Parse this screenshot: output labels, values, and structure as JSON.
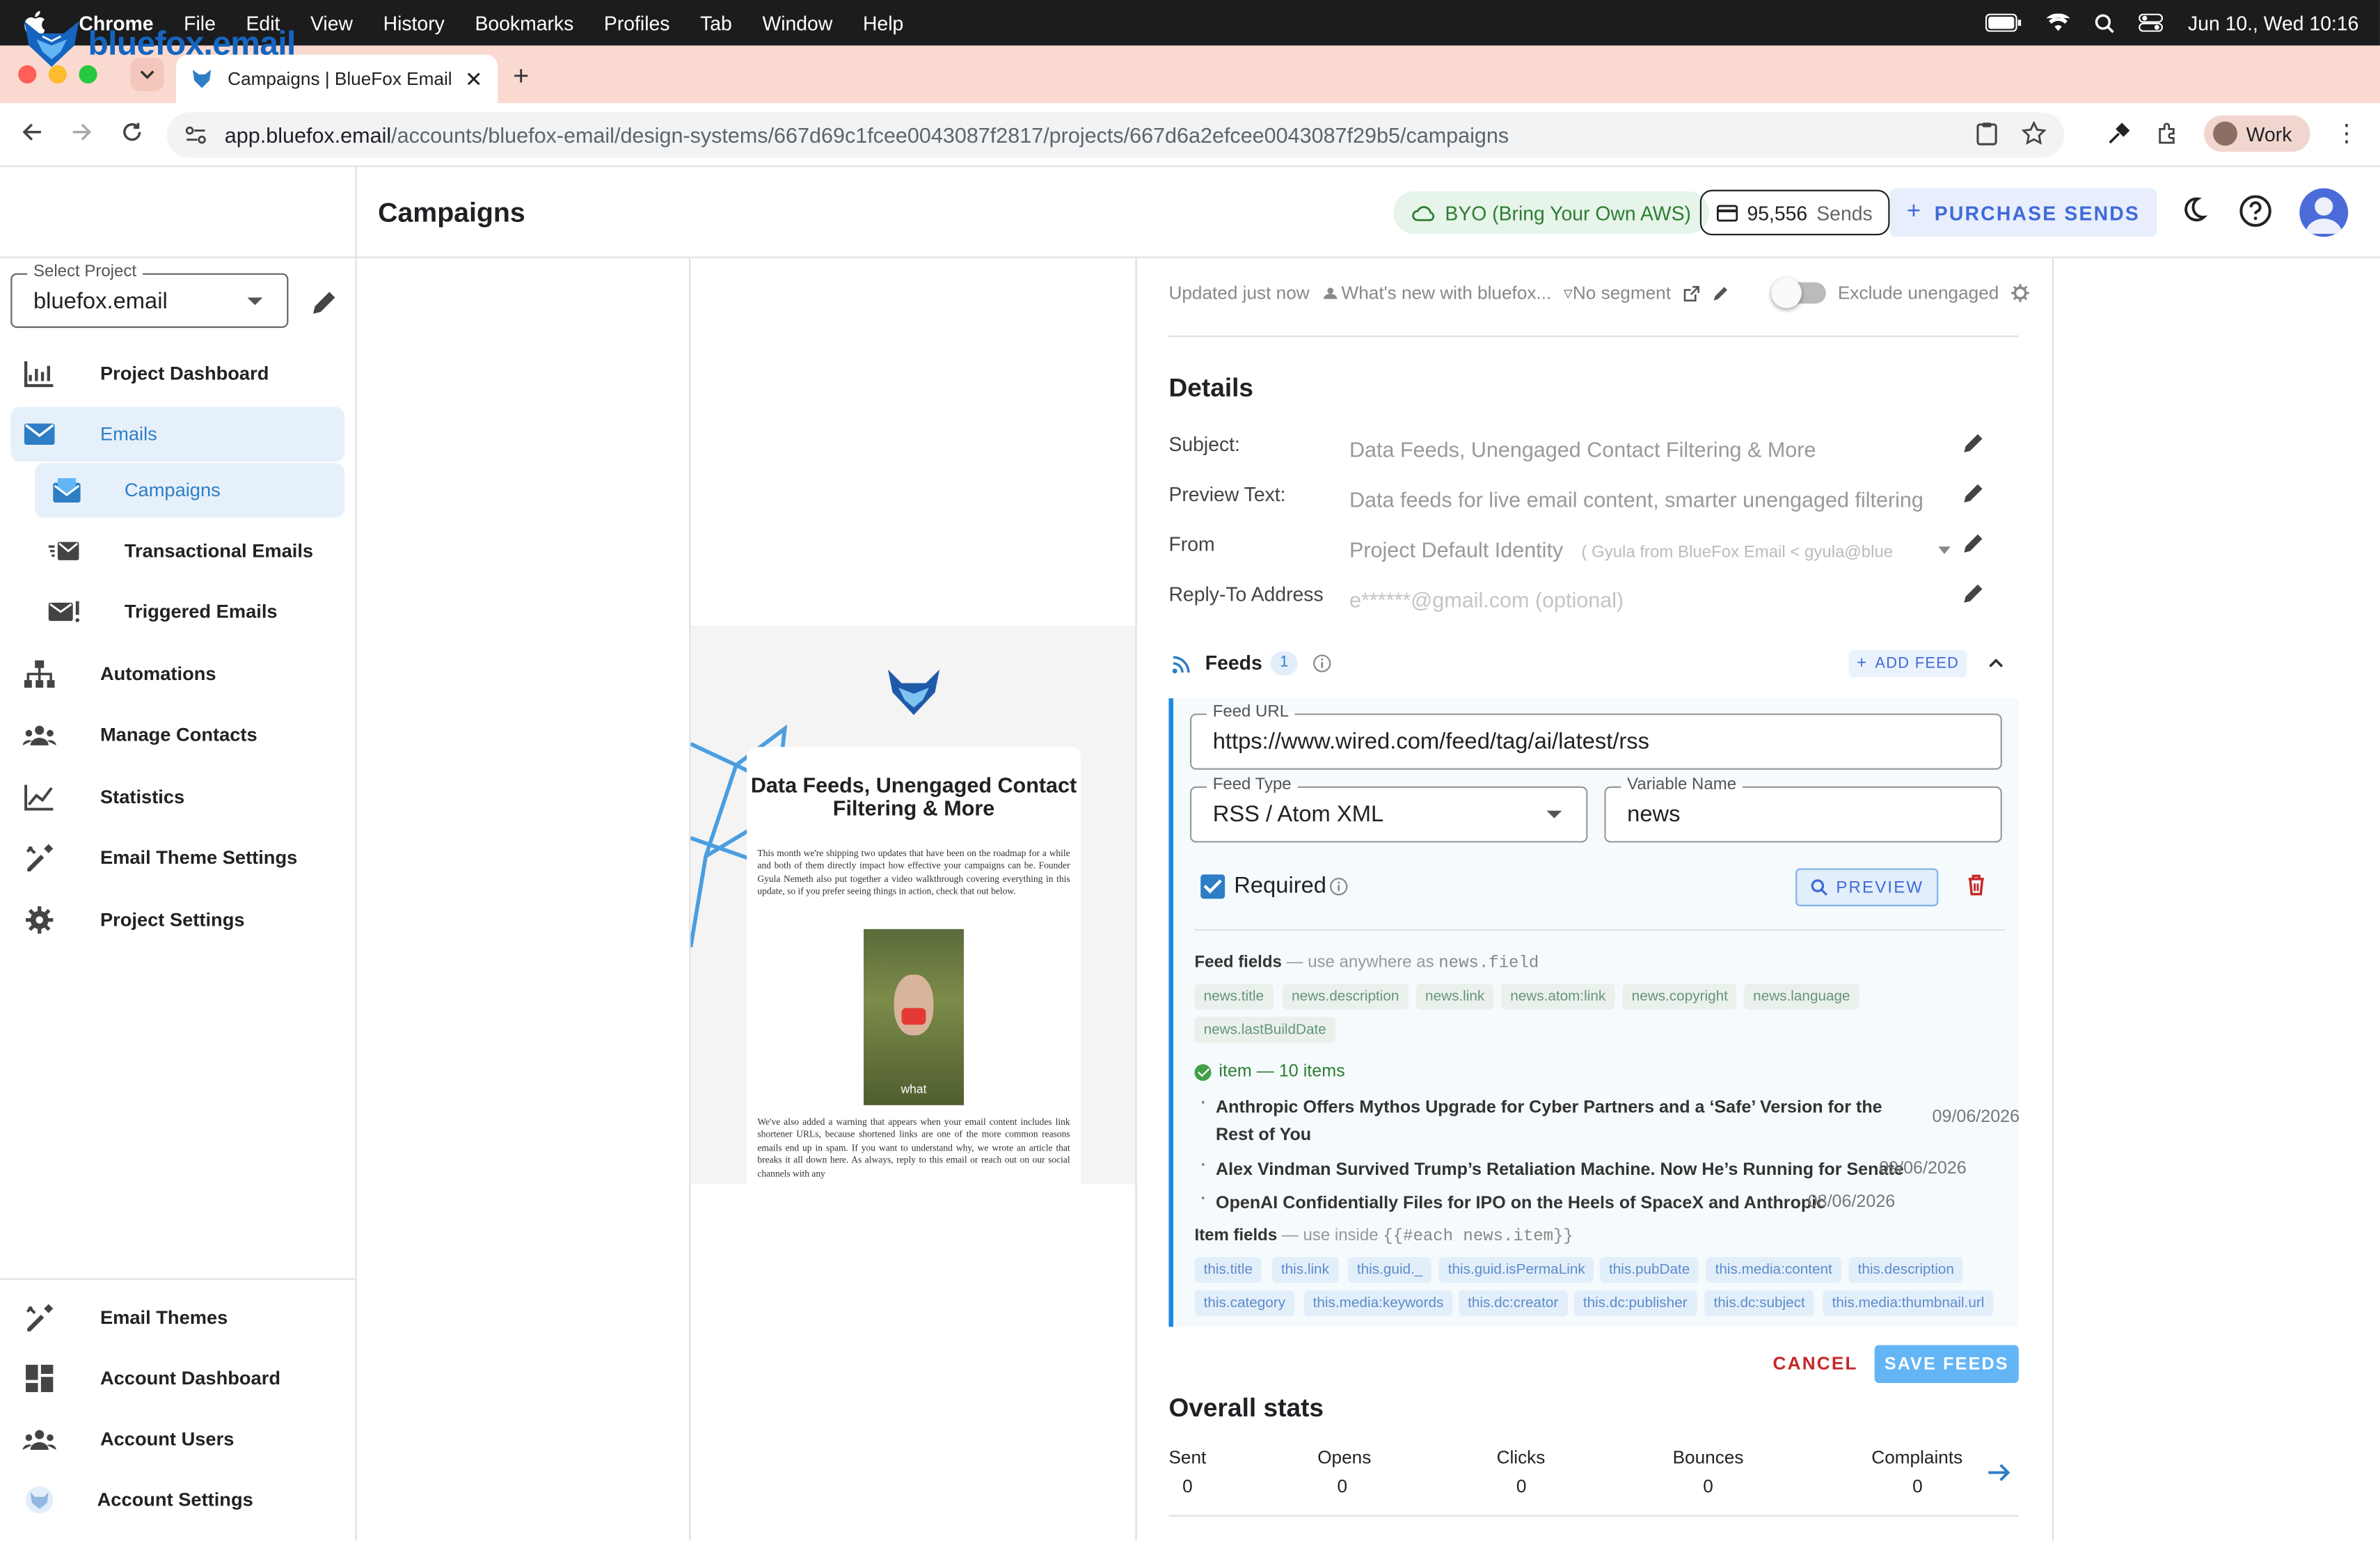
{
  "menubar": {
    "app": "Chrome",
    "menus": [
      "File",
      "Edit",
      "View",
      "History",
      "Bookmarks",
      "Profiles",
      "Tab",
      "Window",
      "Help"
    ],
    "datetime": "Jun 10., Wed  10:16"
  },
  "browser": {
    "tab_title": "Campaigns | BlueFox Email",
    "url_host": "app.bluefox.email",
    "url_path": "/accounts/bluefox-email/design-systems/667d69c1fcee0043087f2817/projects/667d6a2efcee0043087f29b5/campaigns",
    "profile": "Work"
  },
  "header": {
    "logo": "bluefox.email",
    "page_title": "Campaigns",
    "byo_label": "BYO (Bring Your Own AWS)",
    "sends_count": "95,556",
    "sends_label": "Sends",
    "purchase_label": "PURCHASE SENDS"
  },
  "sidebar": {
    "select_label": "Select Project",
    "project": "bluefox.email",
    "items": [
      {
        "label": "Project Dashboard"
      },
      {
        "label": "Emails"
      },
      {
        "label": "Campaigns"
      },
      {
        "label": "Transactional Emails"
      },
      {
        "label": "Triggered Emails"
      },
      {
        "label": "Automations"
      },
      {
        "label": "Manage Contacts"
      },
      {
        "label": "Statistics"
      },
      {
        "label": "Email Theme Settings"
      },
      {
        "label": "Project Settings"
      }
    ],
    "bottom": [
      {
        "label": "Email Themes"
      },
      {
        "label": "Account Dashboard"
      },
      {
        "label": "Account Users"
      },
      {
        "label": "Account Settings"
      }
    ]
  },
  "email_preview": {
    "title": "Data Feeds, Unengaged Contact Filtering & More",
    "para1": "This month we're shipping two updates that have been on the roadmap for a while and both of them directly impact how effective your campaigns can be. Founder Gyula Nemeth also put together a video walkthrough covering everything in this update, so if you prefer seeing things in action, check that out below.",
    "video_caption": "what",
    "para2": "We've also added a warning that appears when your email content includes link shortener URLs, because shortened links are one of the more common reasons emails end up in spam. If you want to understand why, we wrote an article that breaks it all down here. As always, reply to this email or reach out on our social channels with any"
  },
  "meta": {
    "updated": "Updated just now",
    "audience": "What's new with bluefox...",
    "segment": "No segment",
    "exclude": "Exclude unengaged"
  },
  "details": {
    "title": "Details",
    "subject_label": "Subject:",
    "subject": "Data Feeds, Unengaged Contact Filtering & More",
    "preview_label": "Preview Text:",
    "preview": "Data feeds for live email content, smarter unengaged filtering",
    "from_label": "From",
    "from": "Project Default Identity",
    "from_extra": "( Gyula from BlueFox Email < gyula@blue",
    "reply_label": "Reply-To Address",
    "reply_placeholder": "e******@gmail.com (optional)"
  },
  "feeds": {
    "title": "Feeds",
    "count": "1",
    "add_label": "ADD FEED",
    "url_label": "Feed URL",
    "url": "https://www.wired.com/feed/tag/ai/latest/rss",
    "type_label": "Feed Type",
    "type": "RSS / Atom XML",
    "var_label": "Variable Name",
    "var": "news",
    "required_label": "Required",
    "preview_label": "PREVIEW",
    "feed_fields_title": "Feed fields",
    "feed_fields_hint": "— use anywhere as",
    "feed_fields_code": "news.field",
    "feed_fields": [
      "news.title",
      "news.description",
      "news.link",
      "news.atom:link",
      "news.copyright",
      "news.language",
      "news.lastBuildDate"
    ],
    "items_status": "item — 10 items",
    "items": [
      {
        "title": "Anthropic Offers Mythos Upgrade for Cyber Partners and a ‘Safe’ Version for the Rest of You",
        "date": "09/06/2026"
      },
      {
        "title": "Alex Vindman Survived Trump’s Retaliation Machine. Now He’s Running for Senate",
        "date": "09/06/2026"
      },
      {
        "title": "OpenAI Confidentially Files for IPO on the Heels of SpaceX and Anthropic",
        "date": "08/06/2026"
      }
    ],
    "item_fields_title": "Item fields",
    "item_fields_hint": "— use inside",
    "item_fields_code": "{{#each news.item}}",
    "item_fields": [
      "this.title",
      "this.link",
      "this.guid._",
      "this.guid.isPermaLink",
      "this.pubDate",
      "this.media:content",
      "this.description",
      "this.category",
      "this.media:keywords",
      "this.dc:creator",
      "this.dc:publisher",
      "this.dc:subject",
      "this.media:thumbnail.url"
    ],
    "cancel_label": "CANCEL",
    "save_label": "SAVE FEEDS"
  },
  "stats": {
    "title": "Overall stats",
    "labels": [
      "Sent",
      "Opens",
      "Clicks",
      "Bounces",
      "Complaints"
    ],
    "values": [
      "0",
      "0",
      "0",
      "0",
      "0"
    ]
  },
  "colors": {
    "accent": "#2d7ec4",
    "tabstrip": "#f9d9d0",
    "success": "#43a047",
    "danger": "#c62828"
  }
}
